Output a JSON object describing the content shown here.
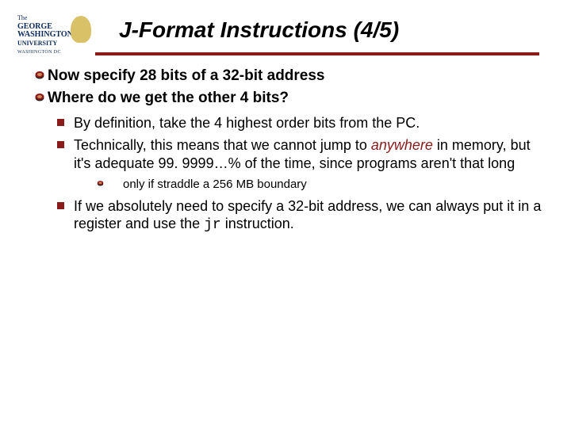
{
  "logo": {
    "the": "The",
    "l1": "GEORGE",
    "l2": "WASHINGTON",
    "l3": "UNIVERSITY",
    "dc": "WASHINGTON DC"
  },
  "title": "J-Format Instructions (4/5)",
  "bullets": {
    "b1": "Now specify 28 bits of a 32-bit address",
    "b2": "Where do we get the other 4 bits?",
    "s1": "By definition, take the 4 highest order bits from the PC.",
    "s2a": "Technically, this means that we cannot jump to ",
    "s2_anywhere": "anywhere",
    "s2b": " in memory, but it's adequate 99. 9999…% of the time, since programs aren't that long",
    "s2_sub": "only if straddle a 256 MB boundary",
    "s3a": "If we absolutely need to specify a 32-bit address, we can always put it in a register and use the ",
    "s3_code": "jr",
    "s3b": " instruction."
  }
}
